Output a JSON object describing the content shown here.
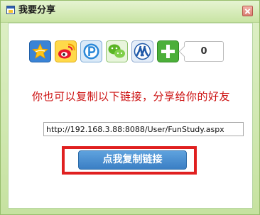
{
  "dialog": {
    "title": "我要分享"
  },
  "share": {
    "icons": [
      {
        "name": "qzone-icon",
        "color": "#2f7bd0"
      },
      {
        "name": "sina-weibo-icon",
        "color": "#e6162d"
      },
      {
        "name": "pengyou-icon",
        "color": "#2b88d8"
      },
      {
        "name": "wechat-icon",
        "color": "#5ab524"
      },
      {
        "name": "renren-icon",
        "color": "#1f58a8"
      },
      {
        "name": "more-share-icon",
        "color": "#4caf3a"
      }
    ],
    "count": "0"
  },
  "hint_text": "你也可以复制以下链接，分享给你的好友",
  "link_value": "http://192.168.3.88:8088/User/FunStudy.aspx",
  "copy_button_label": "点我复制链接",
  "colors": {
    "hint": "#cc1010",
    "button": "#3b7fc4",
    "highlight": "#e02020"
  }
}
